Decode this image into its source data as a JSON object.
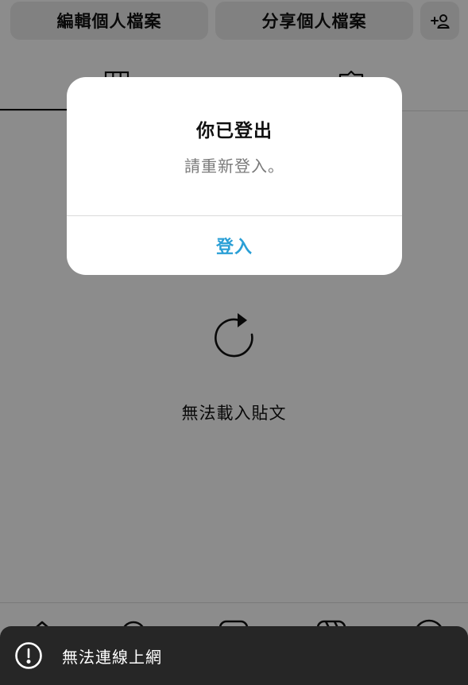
{
  "profile_actions": {
    "edit_label": "編輯個人檔案",
    "share_label": "分享個人檔案"
  },
  "posts": {
    "error_text": "無法載入貼文"
  },
  "dialog": {
    "title": "你已登出",
    "message": "請重新登入。",
    "button_label": "登入"
  },
  "snackbar": {
    "text": "無法連線上網"
  },
  "colors": {
    "accent": "#2a9fd6",
    "snackbar_bg": "#262626",
    "overlay": "rgba(0,0,0,0.45)"
  }
}
